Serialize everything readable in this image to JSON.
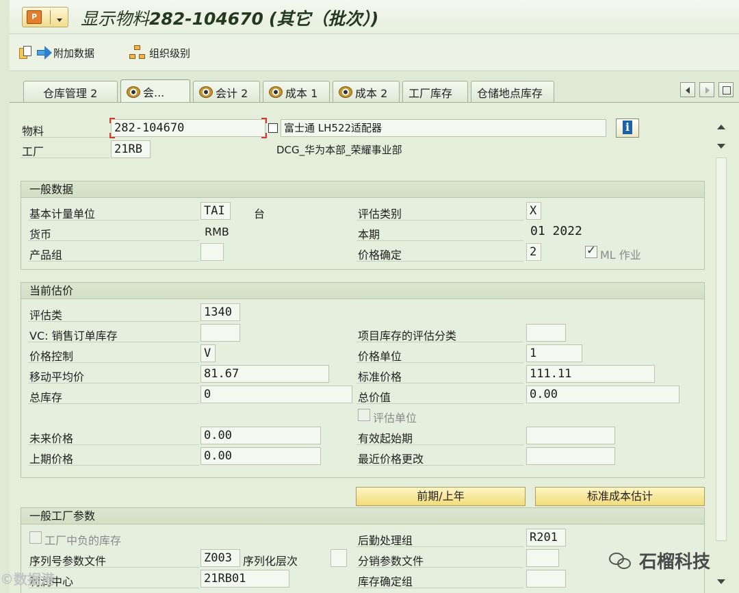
{
  "title": {
    "prefix": "显示物料",
    "material": "282-104670",
    "suffix": "(其它（批次）)"
  },
  "toolbar": {
    "additional_data": "附加数据",
    "org_levels": "组织级别"
  },
  "tabs": [
    {
      "label": "仓库管理 2"
    },
    {
      "label": "会..."
    },
    {
      "label": "会计 2"
    },
    {
      "label": "成本 1"
    },
    {
      "label": "成本 2"
    },
    {
      "label": "工厂库存"
    },
    {
      "label": "仓储地点库存"
    }
  ],
  "header": {
    "material_label": "物料",
    "material_value": "282-104670",
    "material_desc": "富士通 LH522适配器",
    "plant_label": "工厂",
    "plant_value": "21RB",
    "plant_desc": "DCG_华为本部_荣耀事业部"
  },
  "general": {
    "title": "一般数据",
    "base_uom_label": "基本计量单位",
    "base_uom_value": "TAI",
    "base_uom_text": "台",
    "valuation_cat_label": "评估类别",
    "valuation_cat_value": "X",
    "currency_label": "货币",
    "currency_value": "RMB",
    "period_label": "本期",
    "period_value": "01 2022",
    "division_label": "产品组",
    "division_value": "",
    "price_det_label": "价格确定",
    "price_det_value": "2",
    "ml_label": "ML 作业",
    "ml_checked": true
  },
  "valuation": {
    "title": "当前估价",
    "val_class_label": "评估类",
    "val_class_value": "1340",
    "vc_label": "VC: 销售订单库存",
    "vc_value": "",
    "proj_label": "项目库存的评估分类",
    "proj_value": "",
    "price_ctrl_label": "价格控制",
    "price_ctrl_value": "V",
    "price_unit_label": "价格单位",
    "price_unit_value": "1",
    "map_label": "移动平均价",
    "map_value": "81.67",
    "std_label": "标准价格",
    "std_value": "111.11",
    "total_stock_label": "总库存",
    "total_stock_value": "0",
    "total_value_label": "总价值",
    "total_value_value": "0.00",
    "val_unit_label": "评估单位",
    "future_label": "未来价格",
    "future_value": "0.00",
    "valid_from_label": "有效起始期",
    "valid_from_value": "",
    "prev_label": "上期价格",
    "prev_value": "0.00",
    "last_change_label": "最近价格更改",
    "last_change_value": ""
  },
  "buttons": {
    "prev_period": "前期/上年",
    "std_cost_est": "标准成本估计"
  },
  "plant_params": {
    "title": "一般工厂参数",
    "neg_stock_label": "工厂中负的库存",
    "logistics_label": "后勤处理组",
    "logistics_value": "R201",
    "serial_label": "序列号参数文件",
    "serial_value": "Z003",
    "serial_level_label": "序列化层次",
    "serial_level_value": "",
    "distrib_label": "分销参数文件",
    "distrib_value": "",
    "profit_label": "利润中心",
    "profit_value": "21RB01",
    "stock_det_label": "库存确定组",
    "stock_det_value": ""
  },
  "watermark": {
    "right": "石榴科技",
    "left": "©数据港"
  }
}
